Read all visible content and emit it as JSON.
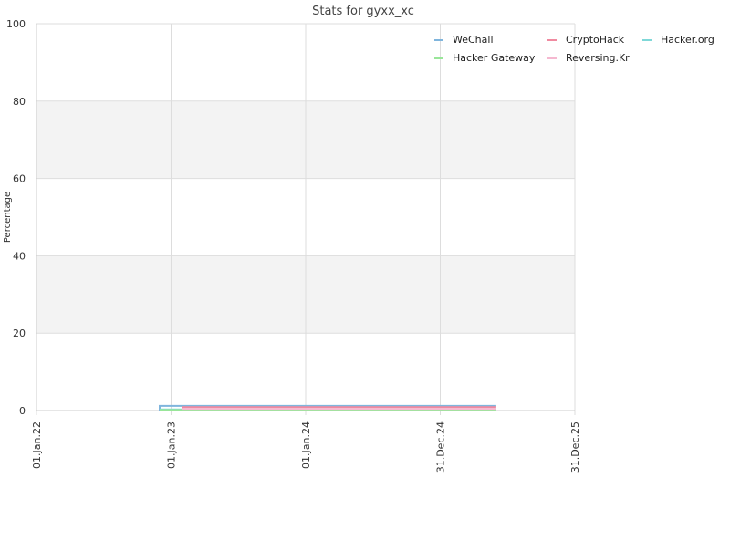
{
  "chart_data": {
    "type": "line",
    "title": "Stats for gyxx_xc",
    "xlabel": "",
    "ylabel": "Percentage",
    "ylim": [
      0,
      100
    ],
    "yticks": [
      0,
      20,
      40,
      60,
      80,
      100
    ],
    "xlim": [
      "2022-01-01",
      "2025-12-31"
    ],
    "xticks": [
      {
        "date": "2022-01-01",
        "label": "01.Jan.22"
      },
      {
        "date": "2023-01-01",
        "label": "01.Jan.23"
      },
      {
        "date": "2024-01-01",
        "label": "01.Jan.24"
      },
      {
        "date": "2024-12-31",
        "label": "31.Dec.24"
      },
      {
        "date": "2025-12-31",
        "label": "31.Dec.25"
      }
    ],
    "grid": true,
    "legend_placement": "top-right",
    "series": [
      {
        "name": "WeChall",
        "color": "#7fb5dd",
        "points": [
          [
            "2022-12-01",
            0
          ],
          [
            "2022-12-01",
            1.2
          ],
          [
            "2025-06-01",
            1.2
          ]
        ]
      },
      {
        "name": "CryptoHack",
        "color": "#f08aa0",
        "points": [
          [
            "2023-02-01",
            0
          ],
          [
            "2023-02-01",
            0.9
          ],
          [
            "2025-06-01",
            0.9
          ]
        ]
      },
      {
        "name": "Hacker.org",
        "color": "#7fd8d8",
        "points": [
          [
            "2022-12-01",
            0.3
          ],
          [
            "2025-06-01",
            0.3
          ]
        ]
      },
      {
        "name": "Hacker Gateway",
        "color": "#99e699",
        "points": [
          [
            "2022-12-01",
            0.15
          ],
          [
            "2025-06-01",
            0.15
          ]
        ]
      },
      {
        "name": "Reversing.Kr",
        "color": "#f5b8d0",
        "points": [
          [
            "2023-02-01",
            0.45
          ],
          [
            "2025-06-01",
            0.45
          ]
        ]
      }
    ]
  }
}
